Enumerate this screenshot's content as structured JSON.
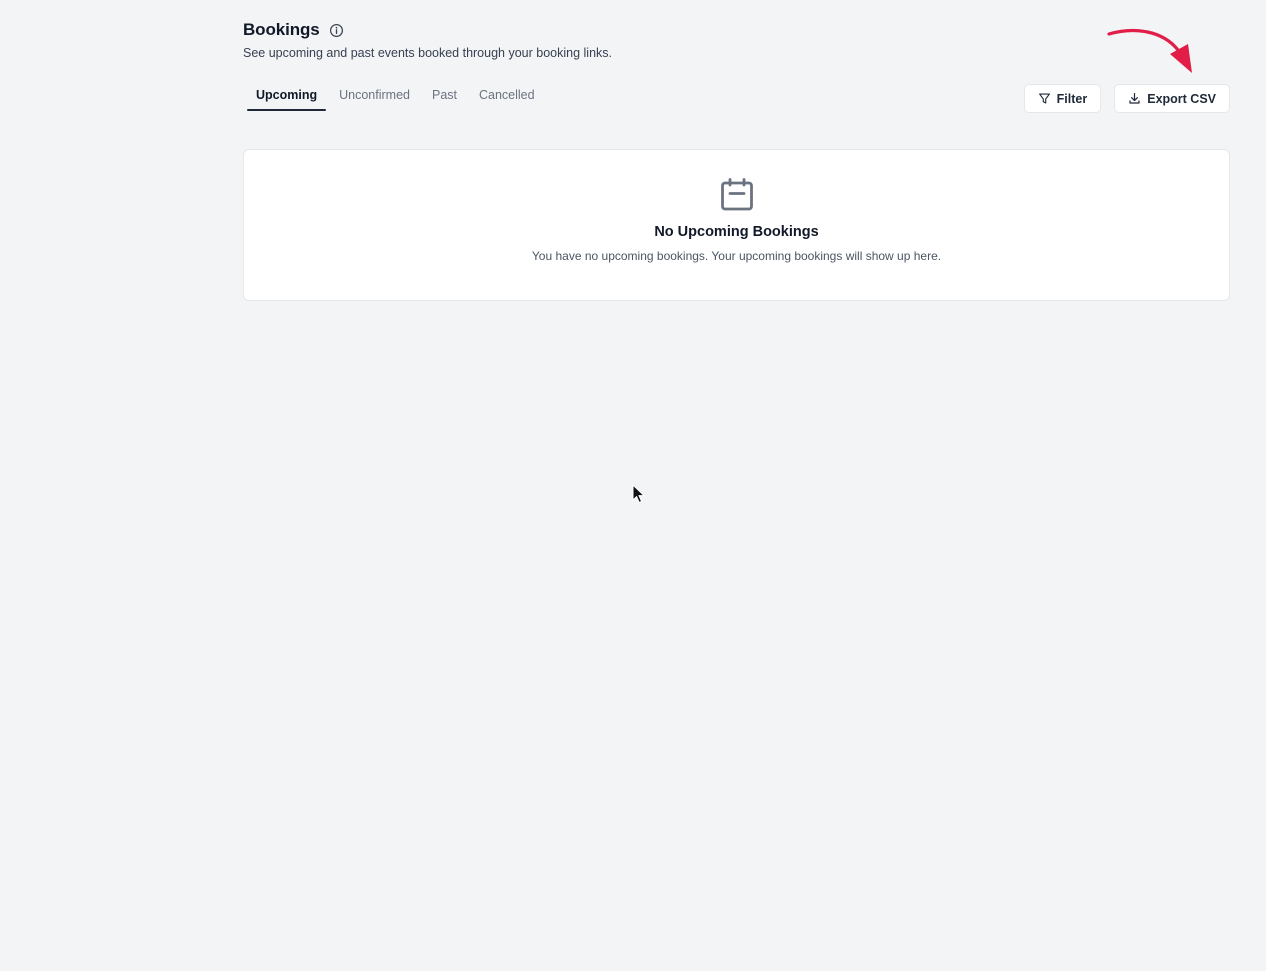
{
  "header": {
    "title": "Bookings",
    "subtitle": "See upcoming and past events booked through your booking links."
  },
  "tabs": [
    {
      "label": "Upcoming",
      "active": true
    },
    {
      "label": "Unconfirmed",
      "active": false
    },
    {
      "label": "Past",
      "active": false
    },
    {
      "label": "Cancelled",
      "active": false
    }
  ],
  "actions": {
    "filter_label": "Filter",
    "filter_icon": "filter-icon",
    "export_label": "Export CSV",
    "export_icon": "download-icon"
  },
  "annotation": {
    "arrow_color": "#e11d48"
  },
  "empty_state": {
    "icon": "calendar-icon",
    "title": "No Upcoming Bookings",
    "description": "You have no upcoming bookings. Your upcoming bookings will show up here."
  },
  "colors": {
    "background": "#f3f4f6",
    "card": "#ffffff",
    "accent": "#1f2937"
  }
}
